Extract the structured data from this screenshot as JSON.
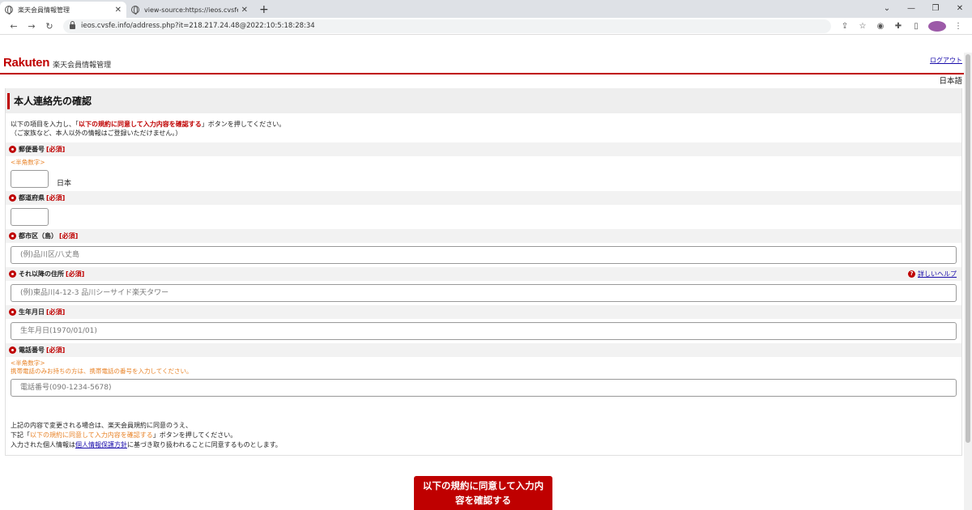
{
  "browser": {
    "tabs": [
      {
        "title": "楽天会員情報管理",
        "active": true
      },
      {
        "title": "view-source:https://ieos.cvsfe.info",
        "active": false
      }
    ],
    "url": "ieos.cvsfe.info/address.php?it=218.217.24.48@2022:10:5:18:28:34"
  },
  "header": {
    "logo": "Rakuten",
    "subtitle": "楽天会員情報管理",
    "logout": "ログアウト",
    "language": "日本語"
  },
  "page": {
    "title": "本人連絡先の確認",
    "intro_before": "以下の項目を入力し、「",
    "intro_highlight": "以下の規約に同意して入力内容を確認する",
    "intro_after": "」ボタンを押してください。",
    "intro_line2": "（ご家族など、本人以外の情報はご登録いただけません。）"
  },
  "form": {
    "required_mark": "[必須]",
    "postal": {
      "label": "郵便番号",
      "hint": "<半角数字>",
      "country": "日本"
    },
    "prefecture": {
      "label": "都道府県"
    },
    "city": {
      "label": "都市区（島）",
      "placeholder": "(例)品川区/八丈島"
    },
    "address": {
      "label": "それ以降の住所",
      "placeholder": "(例)東品川4-12-3 品川シーサイド楽天タワー",
      "help": "詳しいヘルプ"
    },
    "birthday": {
      "label": "生年月日",
      "placeholder": "生年月日(1970/01/01)"
    },
    "phone": {
      "label": "電話番号",
      "hint": "<半角数字>",
      "hint2": "携帯電話のみお持ちの方は、携帯電話の番号を入力してください。",
      "placeholder": "電話番号(090-1234-5678)"
    }
  },
  "footer": {
    "line1": "上記の内容で変更される場合は、楽天会員規約に同意のうえ、",
    "line2_before": "下記「",
    "line2_highlight": "以下の規約に同意して入力内容を確認する",
    "line2_after": "」ボタンを押してください。",
    "line3_before": "入力された個人情報は",
    "line3_link": "個人情報保護方針",
    "line3_after": "に基づき取り扱われることに同意するものとします。",
    "submit_label": "以下の規約に同意して入力内容を確認する"
  }
}
